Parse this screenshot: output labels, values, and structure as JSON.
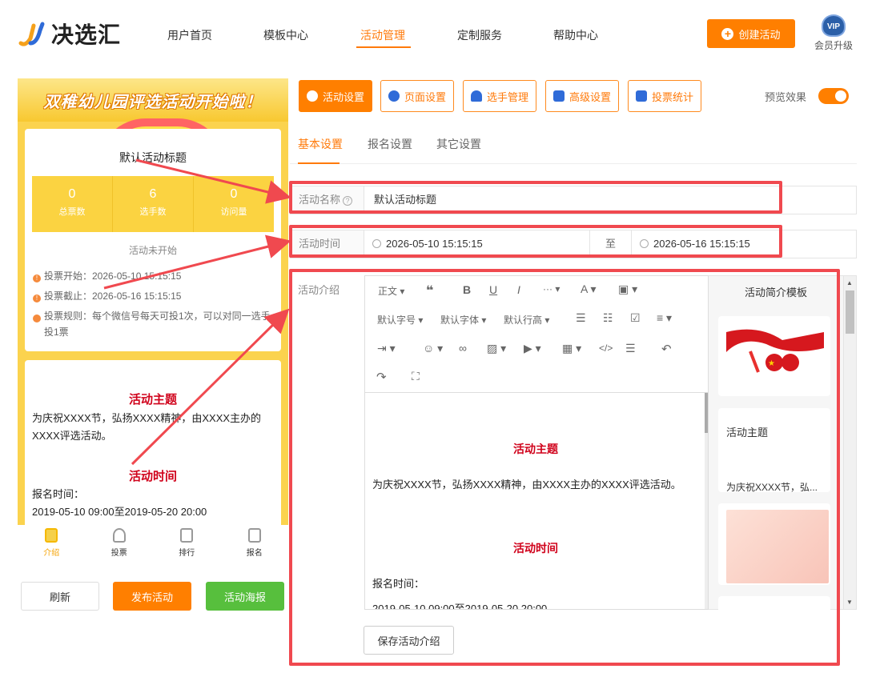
{
  "brand": {
    "name": "决选汇"
  },
  "nav": {
    "items": [
      "用户首页",
      "模板中心",
      "活动管理",
      "定制服务",
      "帮助中心"
    ],
    "active": "活动管理"
  },
  "header": {
    "create_label": "创建活动",
    "vip_badge": "VIP",
    "vip_label": "会员升级"
  },
  "preview": {
    "banner": "双稚幼儿园评选活动开始啦！",
    "title": "默认活动标题",
    "stats": [
      {
        "value": "0",
        "label": "总票数"
      },
      {
        "value": "6",
        "label": "选手数"
      },
      {
        "value": "0",
        "label": "访问量"
      }
    ],
    "status": "活动未开始",
    "vote_start": "投票开始：2026-05-10 15:15:15",
    "vote_end": "投票截止：2026-05-16 15:15:15",
    "vote_rule": "投票规则：每个微信号每天可投1次，可以对同一选手投1票",
    "theme_heading": "活动主题",
    "theme_text": "为庆祝XXXX节，弘扬XXXX精神，由XXXX主办的XXXX评选活动。",
    "time_heading": "活动时间",
    "signup_label": "报名时间：",
    "signup_range": "2019-05-10 09:00至2019-05-20 20:00",
    "tabbar": [
      "介绍",
      "投票",
      "排行",
      "报名"
    ],
    "buttons": {
      "refresh": "刷新",
      "publish": "发布活动",
      "poster": "活动海报"
    }
  },
  "tools": [
    "活动设置",
    "页面设置",
    "选手管理",
    "高级设置",
    "投票统计"
  ],
  "preview_toggle": {
    "label": "预览效果",
    "on": true
  },
  "subtabs": [
    "基本设置",
    "报名设置",
    "其它设置"
  ],
  "form": {
    "name_label": "活动名称",
    "name_value": "默认活动标题",
    "time_label": "活动时间",
    "time_start": "2026-05-10 15:15:15",
    "time_sep": "至",
    "time_end": "2026-05-16 15:15:15",
    "intro_label": "活动介绍"
  },
  "editor": {
    "toolbar": {
      "paragraph": "正文",
      "font_size": "默认字号",
      "font_family": "默认字体",
      "line_height": "默认行高"
    },
    "content": {
      "theme_heading": "活动主题",
      "theme_text": "为庆祝XXXX节，弘扬XXXX精神，由XXXX主办的XXXX评选活动。",
      "time_heading": "活动时间",
      "signup_label": "报名时间：",
      "signup_range": "2019-05-10 09:00至2019-05-20 20:00"
    }
  },
  "templates": {
    "title": "活动简介模板",
    "card2_heading": "活动主题",
    "card2_text": "为庆祝XXXX节，弘..."
  },
  "save_intro": "保存活动介绍",
  "colors": {
    "accent": "#ff7f00",
    "highlight_box": "#f0494f",
    "heading_red": "#d0021b",
    "poster_green": "#57bf3d"
  }
}
